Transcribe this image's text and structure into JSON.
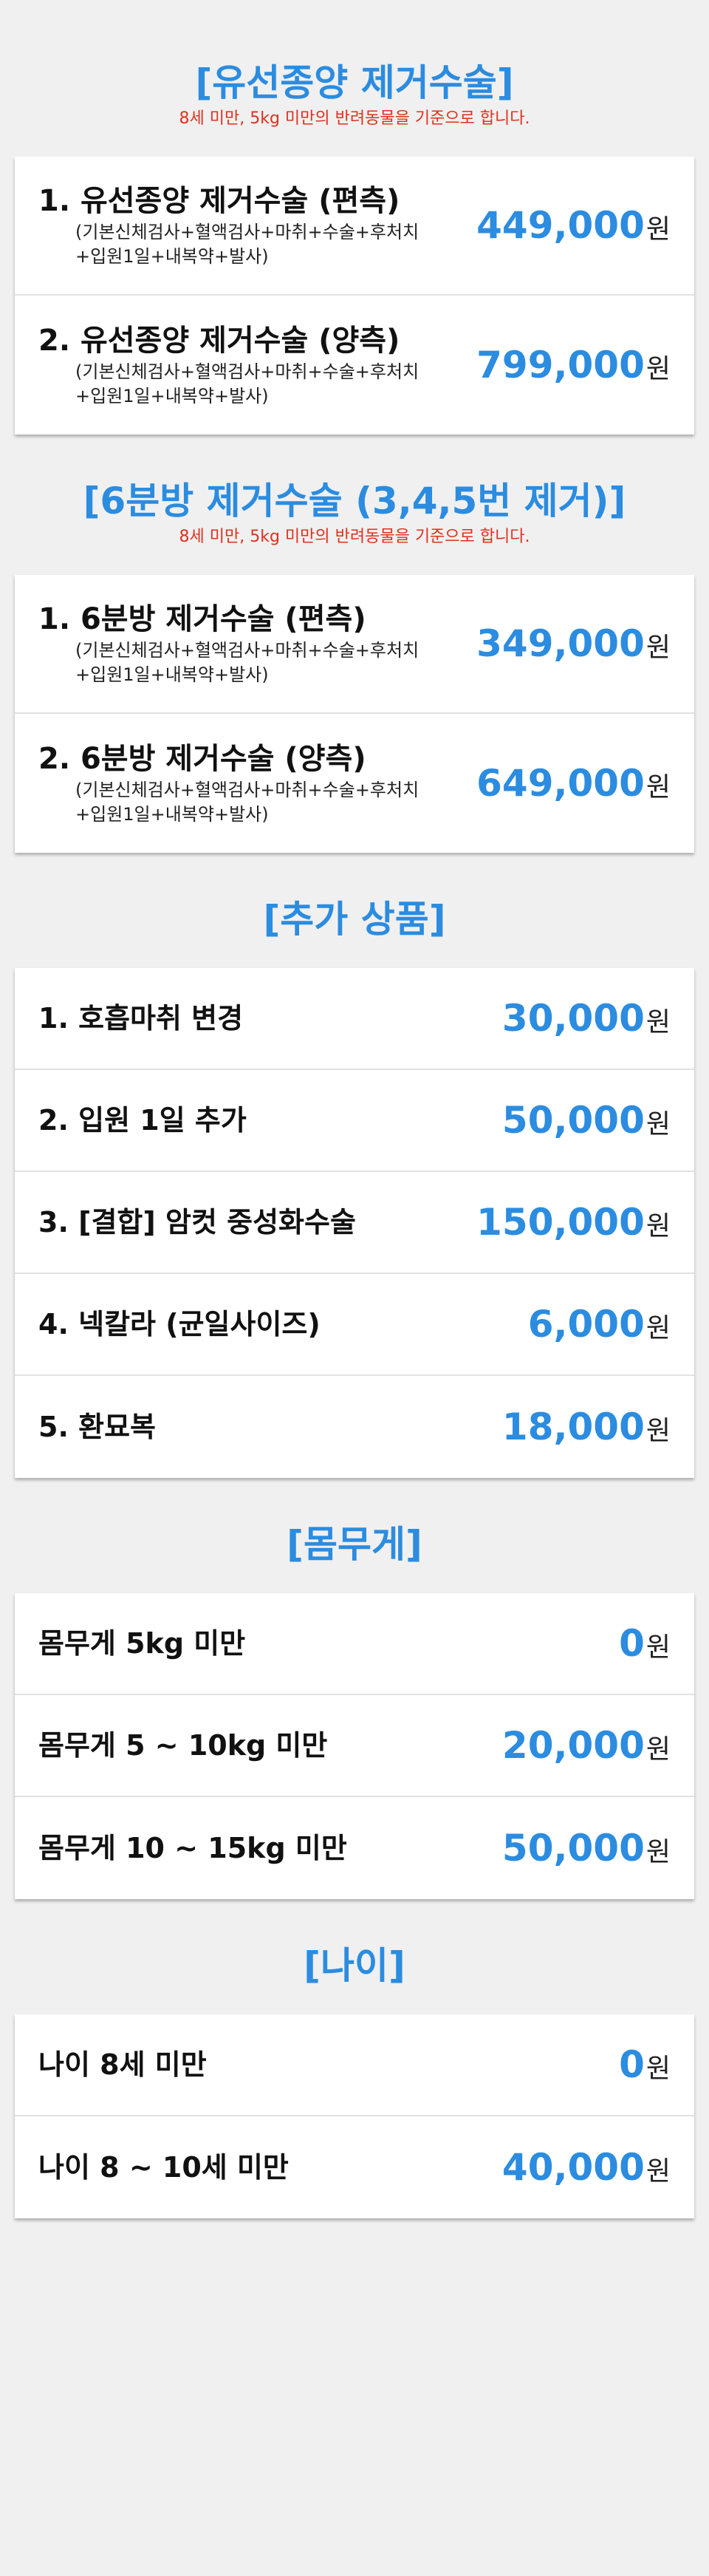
{
  "sections": [
    {
      "title": "[유선종양 제거수술]",
      "subtitle": "8세 미만, 5kg 미만의 반려동물을 기준으로 합니다.",
      "items": [
        {
          "title": "1. 유선종양 제거수술 (편측)",
          "desc1": "(기본신체검사+혈액검사+마취+수술+후처치",
          "desc2": "+입원1일+내복약+발사)",
          "price": "449,000",
          "unit": "원"
        },
        {
          "title": "2. 유선종양 제거수술 (양측)",
          "desc1": "(기본신체검사+혈액검사+마취+수술+후처치",
          "desc2": "+입원1일+내복약+발사)",
          "price": "799,000",
          "unit": "원"
        }
      ]
    },
    {
      "title": "[6분방 제거수술 (3,4,5번 제거)]",
      "subtitle": "8세 미만, 5kg 미만의 반려동물을 기준으로 합니다.",
      "items": [
        {
          "title": "1. 6분방 제거수술 (편측)",
          "desc1": "(기본신체검사+혈액검사+마취+수술+후처치",
          "desc2": "+입원1일+내복약+발사)",
          "price": "349,000",
          "unit": "원"
        },
        {
          "title": "2. 6분방 제거수술 (양측)",
          "desc1": "(기본신체검사+혈액검사+마취+수술+후처치",
          "desc2": "+입원1일+내복약+발사)",
          "price": "649,000",
          "unit": "원"
        }
      ]
    },
    {
      "title": "[추가 상품]",
      "items": [
        {
          "title": "1. 호흡마취 변경",
          "price": "30,000",
          "unit": "원"
        },
        {
          "title": "2. 입원 1일 추가",
          "price": "50,000",
          "unit": "원"
        },
        {
          "title": "3. [결합] 암컷 중성화수술",
          "price": "150,000",
          "unit": "원"
        },
        {
          "title": "4. 넥칼라 (균일사이즈)",
          "price": "6,000",
          "unit": "원"
        },
        {
          "title": "5. 환묘복",
          "price": "18,000",
          "unit": "원"
        }
      ]
    },
    {
      "title": "[몸무게]",
      "items": [
        {
          "title": "몸무게 5kg 미만",
          "price": "0",
          "unit": "원"
        },
        {
          "title": "몸무게 5 ~ 10kg 미만",
          "price": "20,000",
          "unit": "원"
        },
        {
          "title": "몸무게 10 ~ 15kg 미만",
          "price": "50,000",
          "unit": "원"
        }
      ]
    },
    {
      "title": "[나이]",
      "items": [
        {
          "title": "나이 8세 미만",
          "price": "0",
          "unit": "원"
        },
        {
          "title": "나이 8 ~ 10세 미만",
          "price": "40,000",
          "unit": "원"
        }
      ]
    }
  ],
  "colors": {
    "accent": "#2b8ce0",
    "notice": "#e0301e",
    "background": "#f0f0f0"
  }
}
